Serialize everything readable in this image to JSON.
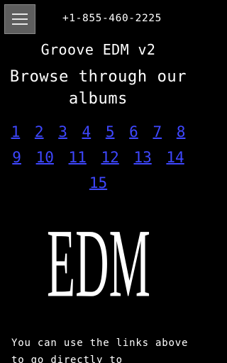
{
  "header": {
    "menu_icon": "hamburger-menu-icon",
    "phone": "+1-855-460-2225"
  },
  "site": {
    "title": "Groove EDM v2",
    "subtitle": "Browse through our albums"
  },
  "pagination": {
    "pages": [
      "1",
      "2",
      "3",
      "4",
      "5",
      "6",
      "7",
      "8",
      "9",
      "10",
      "11",
      "12",
      "13",
      "14",
      "15"
    ],
    "link_color": "#3e47ff"
  },
  "logo": {
    "text": "EDM"
  },
  "body_text": {
    "intro": "You can use the links above to go directly to"
  },
  "colors": {
    "background": "#000000",
    "text": "#ffffff",
    "menu_button": "#5e5e5e"
  }
}
